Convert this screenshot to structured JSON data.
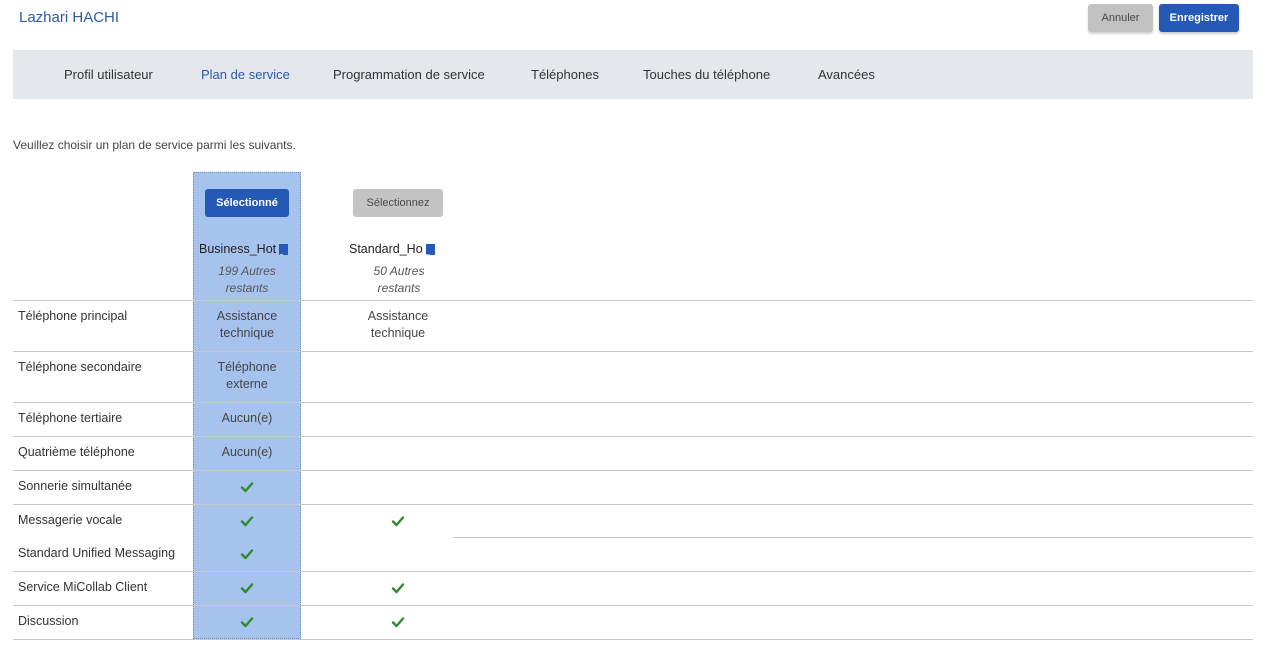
{
  "header": {
    "user_name": "Lazhari HACHI",
    "cancel_label": "Annuler",
    "save_label": "Enregistrer"
  },
  "tabs": [
    {
      "label": "Profil utilisateur",
      "active": false
    },
    {
      "label": "Plan de service",
      "active": true
    },
    {
      "label": "Programmation de service",
      "active": false
    },
    {
      "label": "Téléphones",
      "active": false
    },
    {
      "label": "Touches du téléphone",
      "active": false
    },
    {
      "label": "Avancées",
      "active": false
    }
  ],
  "intro_text": "Veuillez choisir un plan de service parmi les suivants.",
  "plans": [
    {
      "button_label": "Sélectionné",
      "name": "Business_Hot",
      "remaining": "199 Autres restants",
      "selected": true
    },
    {
      "button_label": "Sélectionnez",
      "name": "Standard_Ho",
      "remaining": "50 Autres restants",
      "selected": false
    }
  ],
  "features": [
    {
      "label": "Téléphone principal",
      "plan1": "Assistance technique",
      "plan2": "Assistance technique"
    },
    {
      "label": "Téléphone secondaire",
      "plan1": "Téléphone externe",
      "plan2": ""
    },
    {
      "label": "Téléphone tertiaire",
      "plan1": "Aucun(e)",
      "plan2": ""
    },
    {
      "label": "Quatrième téléphone",
      "plan1": "Aucun(e)",
      "plan2": ""
    },
    {
      "label": "Sonnerie simultanée",
      "plan1": "check",
      "plan2": ""
    },
    {
      "label": "Messagerie vocale",
      "plan1": "check",
      "plan2": "check"
    },
    {
      "label": "Standard Unified Messaging",
      "plan1": "check",
      "plan2": ""
    },
    {
      "label": "Service MiCollab Client",
      "plan1": "check",
      "plan2": "check"
    },
    {
      "label": "Discussion",
      "plan1": "check",
      "plan2": "check"
    }
  ],
  "icons": {
    "check": "checkmark-icon",
    "ellipsis": "ellipsis-icon"
  },
  "colors": {
    "accent": "#2459b5",
    "selected_column": "#a6c3ee",
    "check": "#2e8b2e",
    "tab_bar": "#e4e8ec"
  }
}
